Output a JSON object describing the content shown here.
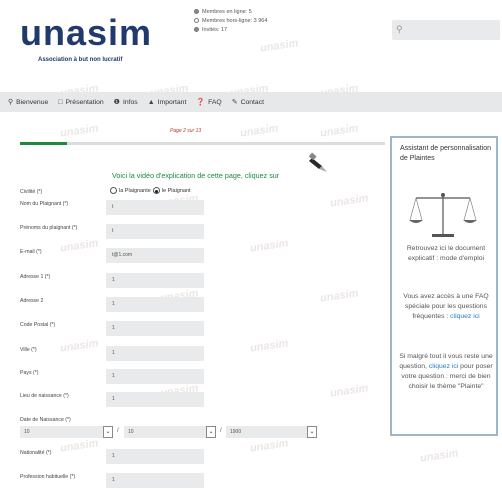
{
  "header": {
    "logo_text": "unasim",
    "logo_subtitle": "Association à but non lucratif",
    "stats": [
      {
        "label": "Membres en ligne: 5",
        "color": "#888888"
      },
      {
        "label": "Membres hors-ligne: 3 964",
        "color": "#ffffff"
      },
      {
        "label": "Invités: 17",
        "color": "#888888"
      }
    ],
    "search_icon": "search-icon"
  },
  "nav": {
    "items": [
      {
        "label": "Bienvenue",
        "icon": "map-marker-icon"
      },
      {
        "label": "Présentation",
        "icon": "monitor-icon"
      },
      {
        "label": "Infos",
        "icon": "info-icon"
      },
      {
        "label": "Important",
        "icon": "warning-icon"
      },
      {
        "label": "FAQ",
        "icon": "question-icon"
      },
      {
        "label": "Contact",
        "icon": "edit-icon"
      }
    ]
  },
  "main": {
    "page_number": "Page 2 sur 13",
    "progress": 0.13,
    "video_link": "Voici la vidéo d'explication de cette page, cliquez sur",
    "form": {
      "civilite_label": "Civilité (*)",
      "radio_options": [
        "la Plaignante",
        "le Plaignant"
      ],
      "radio_selected": 1,
      "fields": [
        {
          "label": "Nom du Plaignant (*)",
          "value": "t"
        },
        {
          "label": "Prénoms du plaignant (*)",
          "value": "t"
        },
        {
          "label": "E-mail (*)",
          "value": "t@1.com"
        },
        {
          "label": "Adresse 1 (*)",
          "value": "1"
        },
        {
          "label": "Adresse 2",
          "value": "1"
        },
        {
          "label": "Code Postal (*)",
          "value": "1"
        },
        {
          "label": "Ville (*)",
          "value": "1"
        },
        {
          "label": "Pays (*)",
          "value": "1"
        },
        {
          "label": "Lieu de naissance (*)",
          "value": "1"
        }
      ],
      "birth_label": "Date de Naissance (*)",
      "birth": {
        "day": "10",
        "month": "10",
        "year": "1900",
        "separator": "/"
      },
      "fields2": [
        {
          "label": "Nationalité (*)",
          "value": "1"
        },
        {
          "label": "Profession habituelle (*)",
          "value": "1"
        }
      ]
    }
  },
  "aside": {
    "title": "Assistant de personnalisation de Plaintes",
    "p1": "Retrouvez ici le document explicatif : mode d'emploi",
    "p2_text": "Vous avez accès à une FAQ spéciale pour les questions fréquentes :",
    "p2_link": "cliquez ici",
    "p3_a": "Si malgré tout il vous reste une question,",
    "p3_link": "cliquez ici",
    "p3_b": "pour poser votre question : merci de bien choisir le thème \"Plainte\""
  },
  "watermark": "unasim"
}
